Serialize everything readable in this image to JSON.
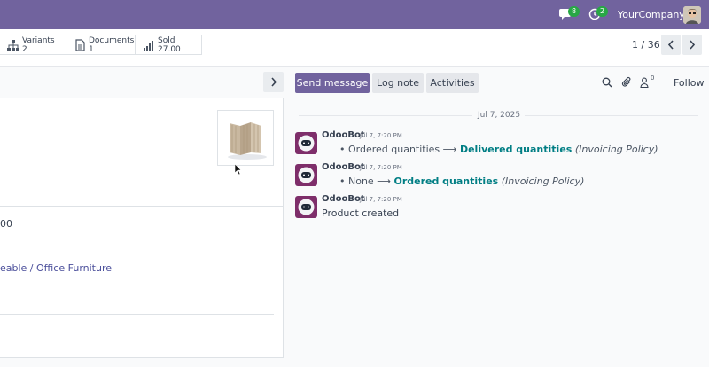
{
  "navbar": {
    "messages_badge": "8",
    "activities_badge": "2",
    "company": "YourCompany",
    "bg_color": "#71639e",
    "badge_color": "#28a745"
  },
  "smart_buttons": [
    {
      "label": "Variants",
      "value": "2",
      "icon": "sitemap-icon"
    },
    {
      "label": "Documents",
      "value": "1",
      "icon": "document-icon"
    },
    {
      "label": "Sold",
      "value": "27.00",
      "icon": "bar-chart-icon"
    }
  ],
  "pager": {
    "value": "1 / 36"
  },
  "form": {
    "fragment_1": "00",
    "category_fragment": "eable / Office Furniture"
  },
  "chatter": {
    "send_message": "Send message",
    "log_note": "Log note",
    "activities": "Activities",
    "follower_count": "0",
    "follow": "Follow",
    "date_separator": "Jul 7, 2025",
    "messages": [
      {
        "author": "OdooBot",
        "time": "Jul 7, 7:20 PM",
        "old": "Ordered quantities",
        "new": "Delivered quantities",
        "field": "(Invoicing Policy)"
      },
      {
        "author": "OdooBot",
        "time": "Jul 7, 7:20 PM",
        "old": "None",
        "new": "Ordered quantities",
        "field": "(Invoicing Policy)"
      },
      {
        "author": "OdooBot",
        "time": "Jul 7, 7:20 PM",
        "body": "Product created"
      }
    ],
    "link_color": "#017e84",
    "primary_color": "#71639e"
  }
}
